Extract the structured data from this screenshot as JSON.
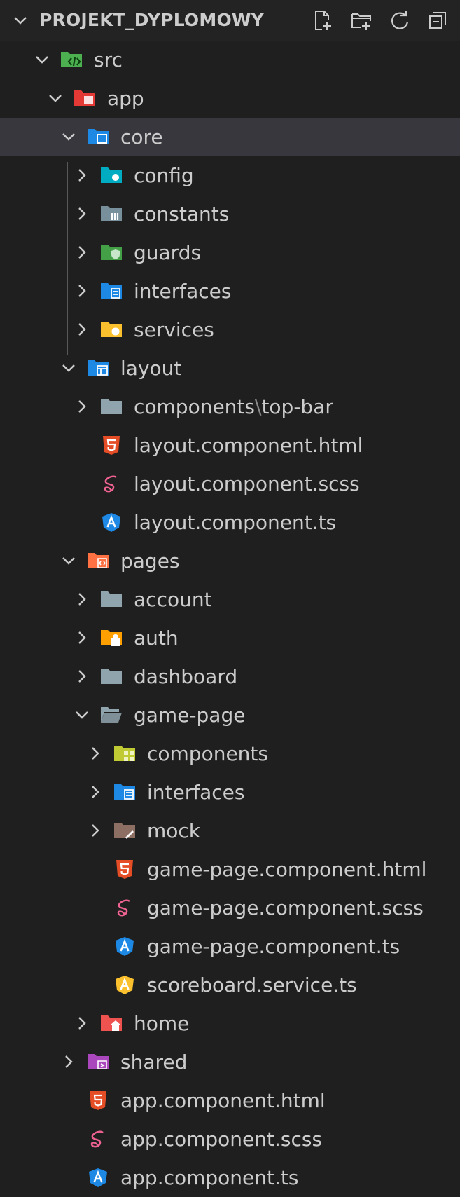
{
  "explorer": {
    "title": "PROJEKT_DYPLOMOWY",
    "actions": [
      {
        "name": "new-file-icon"
      },
      {
        "name": "new-folder-icon"
      },
      {
        "name": "refresh-icon"
      },
      {
        "name": "collapse-all-icon"
      }
    ]
  },
  "tree": [
    {
      "label": "src",
      "depth": 0,
      "kind": "folder",
      "expanded": true,
      "icon": "src-folder-icon",
      "color": "#4caf50"
    },
    {
      "label": "app",
      "depth": 1,
      "kind": "folder",
      "expanded": true,
      "icon": "app-folder-icon",
      "color": "#e53935"
    },
    {
      "label": "core",
      "depth": 2,
      "kind": "folder",
      "expanded": true,
      "icon": "core-folder-icon",
      "color": "#1e88e5",
      "selected": true
    },
    {
      "label": "config",
      "depth": 3,
      "kind": "folder",
      "expanded": false,
      "icon": "config-folder-icon",
      "color": "#00acc1"
    },
    {
      "label": "constants",
      "depth": 3,
      "kind": "folder",
      "expanded": false,
      "icon": "constants-folder-icon",
      "color": "#78909c"
    },
    {
      "label": "guards",
      "depth": 3,
      "kind": "folder",
      "expanded": false,
      "icon": "guards-folder-icon",
      "color": "#43a047"
    },
    {
      "label": "interfaces",
      "depth": 3,
      "kind": "folder",
      "expanded": false,
      "icon": "interfaces-folder-icon",
      "color": "#1e88e5"
    },
    {
      "label": "services",
      "depth": 3,
      "kind": "folder",
      "expanded": false,
      "icon": "services-folder-icon",
      "color": "#fbc02d"
    },
    {
      "label": "layout",
      "depth": 2,
      "kind": "folder",
      "expanded": true,
      "icon": "layout-folder-icon",
      "color": "#1e88e5"
    },
    {
      "label": "components",
      "label_sep": "\\",
      "label_tail": "top-bar",
      "depth": 3,
      "kind": "folder",
      "expanded": false,
      "icon": "folder-icon",
      "color": "#90a4ae"
    },
    {
      "label": "layout.component.html",
      "depth": 3,
      "kind": "file",
      "icon": "html-file-icon",
      "color": "#e44d26"
    },
    {
      "label": "layout.component.scss",
      "depth": 3,
      "kind": "file",
      "icon": "scss-file-icon",
      "color": "#f06292"
    },
    {
      "label": "layout.component.ts",
      "depth": 3,
      "kind": "file",
      "icon": "angular-component-icon",
      "color": "#1e88e5"
    },
    {
      "label": "pages",
      "depth": 2,
      "kind": "folder",
      "expanded": true,
      "icon": "pages-folder-icon",
      "color": "#ff7043"
    },
    {
      "label": "account",
      "depth": 3,
      "kind": "folder",
      "expanded": false,
      "icon": "folder-icon",
      "color": "#90a4ae"
    },
    {
      "label": "auth",
      "depth": 3,
      "kind": "folder",
      "expanded": false,
      "icon": "auth-folder-icon",
      "color": "#ffa000"
    },
    {
      "label": "dashboard",
      "depth": 3,
      "kind": "folder",
      "expanded": false,
      "icon": "folder-icon",
      "color": "#90a4ae"
    },
    {
      "label": "game-page",
      "depth": 3,
      "kind": "folder",
      "expanded": true,
      "icon": "folder-open-icon",
      "color": "#90a4ae"
    },
    {
      "label": "components",
      "depth": 4,
      "kind": "folder",
      "expanded": false,
      "icon": "components-folder-icon",
      "color": "#c0ca33"
    },
    {
      "label": "interfaces",
      "depth": 4,
      "kind": "folder",
      "expanded": false,
      "icon": "interfaces-folder-icon",
      "color": "#1e88e5"
    },
    {
      "label": "mock",
      "depth": 4,
      "kind": "folder",
      "expanded": false,
      "icon": "mock-folder-icon",
      "color": "#8d6e63"
    },
    {
      "label": "game-page.component.html",
      "depth": 4,
      "kind": "file",
      "icon": "html-file-icon",
      "color": "#e44d26"
    },
    {
      "label": "game-page.component.scss",
      "depth": 4,
      "kind": "file",
      "icon": "scss-file-icon",
      "color": "#f06292"
    },
    {
      "label": "game-page.component.ts",
      "depth": 4,
      "kind": "file",
      "icon": "angular-component-icon",
      "color": "#1e88e5"
    },
    {
      "label": "scoreboard.service.ts",
      "depth": 4,
      "kind": "file",
      "icon": "angular-service-icon",
      "color": "#fbc02d"
    },
    {
      "label": "home",
      "depth": 3,
      "kind": "folder",
      "expanded": false,
      "icon": "home-folder-icon",
      "color": "#ef5350"
    },
    {
      "label": "shared",
      "depth": 2,
      "kind": "folder",
      "expanded": false,
      "icon": "shared-folder-icon",
      "color": "#ab47bc"
    },
    {
      "label": "app.component.html",
      "depth": 2,
      "kind": "file",
      "icon": "html-file-icon",
      "color": "#e44d26"
    },
    {
      "label": "app.component.scss",
      "depth": 2,
      "kind": "file",
      "icon": "scss-file-icon",
      "color": "#f06292"
    },
    {
      "label": "app.component.ts",
      "depth": 2,
      "kind": "file",
      "icon": "angular-component-icon",
      "color": "#1e88e5"
    }
  ]
}
